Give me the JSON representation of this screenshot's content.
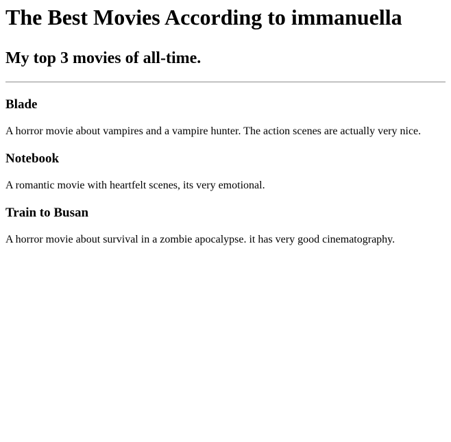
{
  "title": "The Best Movies According to immanuella",
  "subtitle": "My top 3 movies of all-time.",
  "movies": [
    {
      "title": "Blade",
      "description": "A horror movie about vampires and a vampire hunter. The action scenes are actually very nice."
    },
    {
      "title": "Notebook",
      "description": "A romantic movie with heartfelt scenes, its very emotional."
    },
    {
      "title": "Train to Busan",
      "description": "A horror movie about survival in a zombie apocalypse. it has very good cinematography."
    }
  ]
}
